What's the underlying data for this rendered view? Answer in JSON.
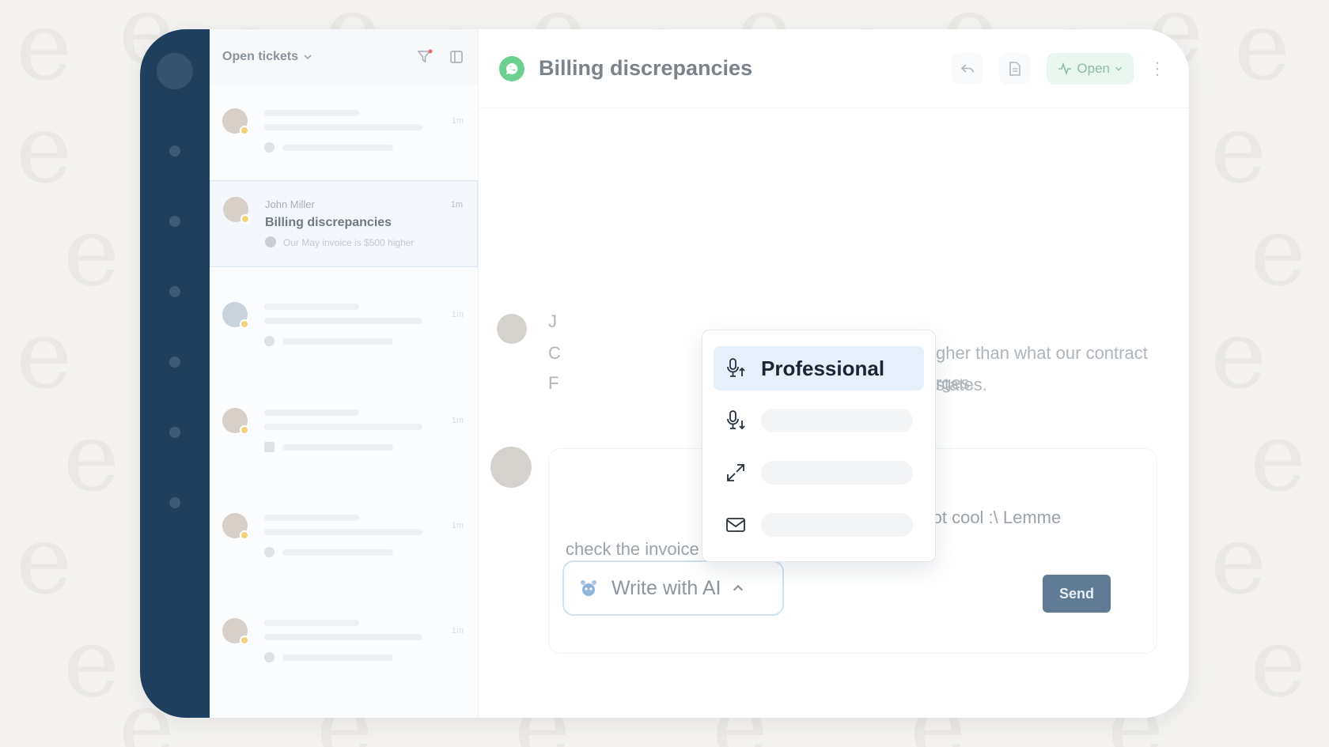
{
  "list": {
    "header_title": "Open tickets",
    "active_ticket": {
      "sender": "John Miller",
      "subject": "Billing discrepancies",
      "preview": "Our May invoice is $500 higher",
      "time": "1m"
    },
    "placeholder_time": "1m"
  },
  "conversation": {
    "title": "Billing discrepancies",
    "status_label": "Open",
    "customer_message_line1_visible": "gher than what our contract states.",
    "customer_message_line2_visible": "rges.",
    "customer_initial_1": "J",
    "customer_initial_2": "C",
    "customer_initial_3": "F",
    "reply_text_line1": "g out! That’s not cool :\\ Lemme",
    "reply_text_line2": "check the invoice & get back to u ASAP.",
    "ai_button_label": "Write with AI",
    "send_label": "Send"
  },
  "ai_menu": {
    "selected_label": "Professional",
    "items": [
      {
        "icon": "mic-up-icon"
      },
      {
        "icon": "mic-down-icon"
      },
      {
        "icon": "expand-icon"
      },
      {
        "icon": "mail-icon"
      }
    ]
  },
  "colors": {
    "rail": "#1f3f5e",
    "accent": "#5f7b95",
    "whatsapp": "#6cd08f",
    "selected_bg": "#e6f0fb"
  }
}
